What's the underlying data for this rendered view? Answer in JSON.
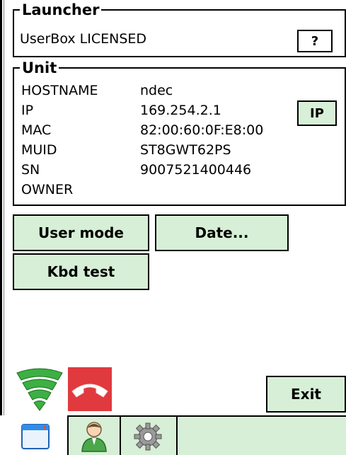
{
  "launcher": {
    "legend": "Launcher",
    "status": "UserBox LICENSED",
    "help_label": "?"
  },
  "unit": {
    "legend": "Unit",
    "rows": [
      {
        "label": "HOSTNAME",
        "value": "ndec"
      },
      {
        "label": "IP",
        "value": "169.254.2.1"
      },
      {
        "label": "MAC",
        "value": "82:00:60:0F:E8:00"
      },
      {
        "label": "MUID",
        "value": "ST8GWT62PS"
      },
      {
        "label": "SN",
        "value": "9007521400446"
      },
      {
        "label": "OWNER",
        "value": ""
      }
    ],
    "ip_button_label": "IP"
  },
  "actions": {
    "user_mode": "User mode",
    "date": "Date...",
    "kbd_test": "Kbd test"
  },
  "status_icons": {
    "wifi": "wifi-signal-icon",
    "phone": "phone-hangup-icon",
    "colors": {
      "wifi_green": "#3cb043",
      "phone_red": "#e0393e"
    }
  },
  "exit_label": "Exit",
  "tabs": [
    {
      "icon": "window-icon",
      "active": true
    },
    {
      "icon": "user-icon",
      "active": false
    },
    {
      "icon": "gear-icon",
      "active": false
    }
  ],
  "colors": {
    "accent_green": "#d6efd6",
    "border": "#000000"
  }
}
